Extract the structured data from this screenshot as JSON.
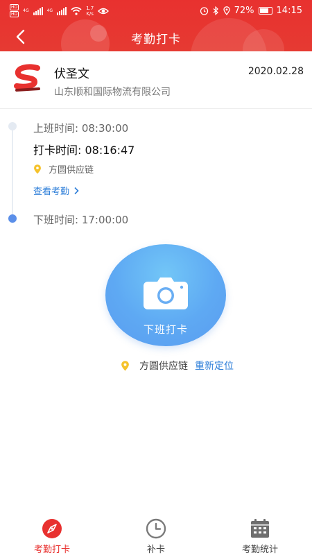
{
  "statusbar": {
    "sim1": "HD",
    "sim2": "HD",
    "net1": "4G",
    "net2": "4G",
    "speed_value": "1.7",
    "speed_unit": "K/s",
    "battery": "72%",
    "time": "14:15"
  },
  "header": {
    "title": "考勤打卡"
  },
  "profile": {
    "name": "伏圣文",
    "company": "山东顺和国际物流有限公司",
    "date": "2020.02.28"
  },
  "timeline": {
    "work_start": "上班时间: 08:30:00",
    "checkin_time": "打卡时间: 08:16:47",
    "checkin_location": "方圆供应链",
    "view_attendance": "查看考勤",
    "work_end": "下班时间: 17:00:00"
  },
  "punch": {
    "label": "下班打卡",
    "location": "方圆供应链",
    "relocate": "重新定位"
  },
  "tabs": [
    {
      "label": "考勤打卡",
      "icon": "compass-icon",
      "active": true
    },
    {
      "label": "补卡",
      "icon": "clock-icon",
      "active": false
    },
    {
      "label": "考勤统计",
      "icon": "calendar-icon",
      "active": false
    }
  ],
  "colors": {
    "accent_red": "#e8312f",
    "link_blue": "#2f7fd9",
    "punch_blue": "#5ea9f3",
    "pin_yellow": "#f5c22b"
  }
}
